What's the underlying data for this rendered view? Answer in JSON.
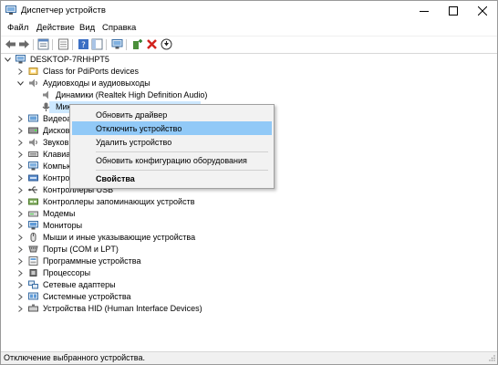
{
  "window": {
    "title": "Диспетчер устройств"
  },
  "menu": [
    "Файл",
    "Действие",
    "Вид",
    "Справка"
  ],
  "tree": [
    {
      "label": "DESKTOP-7RHHPT5",
      "expander": "open",
      "icon": "computer-icon"
    },
    {
      "label": "Class for PdiPorts devices",
      "expander": "closed",
      "icon": "pdiports-icon"
    },
    {
      "label": "Аудиовходы и аудиовыходы",
      "expander": "open",
      "icon": "audio-io-icon"
    },
    {
      "label": "Динамики (Realtek High Definition Audio)",
      "expander": "none",
      "icon": "speaker-icon"
    },
    {
      "label": "Микр",
      "expander": "none",
      "icon": "microphone-icon",
      "selected": true
    },
    {
      "label": "Видеоа",
      "expander": "closed",
      "icon": "video-adapter-icon"
    },
    {
      "label": "Дисков",
      "expander": "closed",
      "icon": "disk-drive-icon"
    },
    {
      "label": "Звуковы",
      "expander": "closed",
      "icon": "sound-device-icon"
    },
    {
      "label": "Клавиату",
      "expander": "closed",
      "icon": "keyboard-icon"
    },
    {
      "label": "Компьют",
      "expander": "closed",
      "icon": "computer-icon"
    },
    {
      "label": "Контрол",
      "expander": "closed",
      "icon": "ide-controller-icon"
    },
    {
      "label": "Контроллеры USB",
      "expander": "closed",
      "icon": "usb-icon"
    },
    {
      "label": "Контроллеры запоминающих устройств",
      "expander": "closed",
      "icon": "storage-controller-icon"
    },
    {
      "label": "Модемы",
      "expander": "closed",
      "icon": "modem-icon"
    },
    {
      "label": "Мониторы",
      "expander": "closed",
      "icon": "monitor-icon"
    },
    {
      "label": "Мыши и иные указывающие устройства",
      "expander": "closed",
      "icon": "mouse-icon"
    },
    {
      "label": "Порты (COM и LPT)",
      "expander": "closed",
      "icon": "port-icon"
    },
    {
      "label": "Программные устройства",
      "expander": "closed",
      "icon": "software-device-icon"
    },
    {
      "label": "Процессоры",
      "expander": "closed",
      "icon": "processor-icon"
    },
    {
      "label": "Сетевые адаптеры",
      "expander": "closed",
      "icon": "network-adapter-icon"
    },
    {
      "label": "Системные устройства",
      "expander": "closed",
      "icon": "system-device-icon"
    },
    {
      "label": "Устройства HID (Human Interface Devices)",
      "expander": "closed",
      "icon": "hid-icon"
    }
  ],
  "context_menu": {
    "items": [
      {
        "label": "Обновить драйвер",
        "bold": false
      },
      {
        "label": "Отключить устройство",
        "bold": false,
        "highlighted": true
      },
      {
        "label": "Удалить устройство",
        "bold": false
      },
      {
        "label": "Обновить конфигурацию оборудования",
        "bold": false
      },
      {
        "label": "Свойства",
        "bold": true
      }
    ]
  },
  "statusbar": {
    "text": "Отключение выбранного устройства."
  },
  "colors": {
    "selection": "#cde8ff",
    "menu_highlight": "#91c9f7",
    "menu_bg": "#f2f2f2"
  }
}
